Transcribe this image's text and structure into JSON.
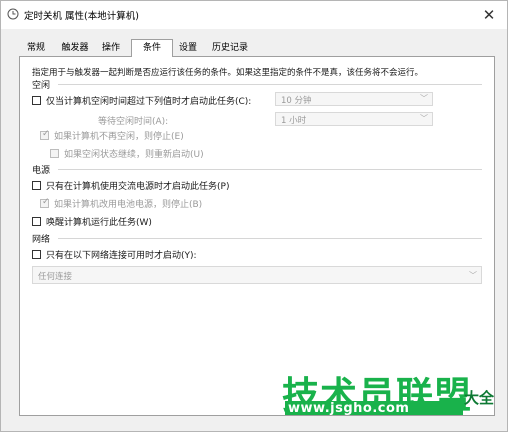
{
  "window": {
    "title": "定时关机 属性(本地计算机)",
    "close_glyph": "✕"
  },
  "tabs": [
    {
      "label": "常规",
      "active": false
    },
    {
      "label": "触发器",
      "active": false
    },
    {
      "label": "操作",
      "active": false
    },
    {
      "label": "条件",
      "active": true
    },
    {
      "label": "设置",
      "active": false
    },
    {
      "label": "历史记录",
      "active": false
    }
  ],
  "conditions": {
    "description": "指定用于与触发器一起判断是否应运行该任务的条件。如果这里指定的条件不是真，该任务将不会运行。",
    "idle": {
      "section": "空闲",
      "start_if_idle": {
        "label": "仅当计算机空闲时间超过下列值时才启动此任务(C):",
        "checked": false,
        "value": "10 分钟"
      },
      "wait_for_idle": {
        "label": "等待空闲时间(A):",
        "value": "1 小时"
      },
      "stop_if_not_idle": {
        "label": "如果计算机不再空闲，则停止(E)",
        "checked": true,
        "enabled": false
      },
      "restart_if_idle": {
        "label": "如果空闲状态继续，则重新启动(U)",
        "checked": false,
        "enabled": false
      }
    },
    "power": {
      "section": "电源",
      "ac_only": {
        "label": "只有在计算机使用交流电源时才启动此任务(P)",
        "checked": false
      },
      "stop_on_battery": {
        "label": "如果计算机改用电池电源，则停止(B)",
        "checked": true,
        "enabled": false
      },
      "wake_to_run": {
        "label": "唤醒计算机运行此任务(W)",
        "checked": false
      }
    },
    "network": {
      "section": "网络",
      "only_if_network": {
        "label": "只有在以下网络连接可用时才启动(Y):",
        "checked": false
      },
      "connection": "任何连接"
    }
  },
  "watermark": {
    "line1": "技术员联盟",
    "line2": "www.jsgho.com",
    "suffix": "大全"
  },
  "colors": {
    "watermark_green": "#19b24b",
    "watermark_dark": "#0e7a34"
  }
}
